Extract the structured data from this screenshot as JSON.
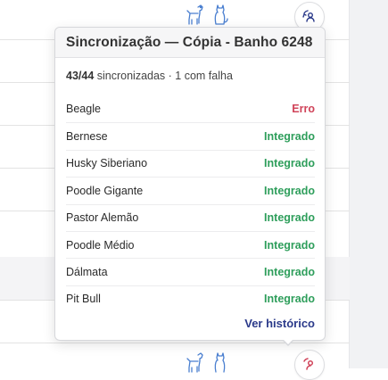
{
  "popover": {
    "title": "Sincronização — Cópia - Banho 6248",
    "summary_count": "43/44",
    "summary_rest": " sincronizadas · 1 com falha",
    "footer_link": "Ver histórico"
  },
  "rows": [
    {
      "name": "Beagle",
      "status": "Erro",
      "state": "error"
    },
    {
      "name": "Bernese",
      "status": "Integrado",
      "state": "ok"
    },
    {
      "name": "Husky Siberiano",
      "status": "Integrado",
      "state": "ok"
    },
    {
      "name": "Poodle Gigante",
      "status": "Integrado",
      "state": "ok"
    },
    {
      "name": "Pastor Alemão",
      "status": "Integrado",
      "state": "ok"
    },
    {
      "name": "Poodle Médio",
      "status": "Integrado",
      "state": "ok"
    },
    {
      "name": "Dálmata",
      "status": "Integrado",
      "state": "ok"
    },
    {
      "name": "Pit Bull",
      "status": "Integrado",
      "state": "ok"
    }
  ],
  "colors": {
    "ok": "#2e9e5b",
    "error": "#d0445a",
    "link": "#2b3a8a",
    "pet_icon": "#4a7fd0"
  },
  "icons": {
    "top_pets": [
      "dog-icon",
      "cat-icon"
    ],
    "bottom_pets": [
      "dog-icon",
      "cat-icon"
    ],
    "top_sync": "sync-user-icon",
    "bottom_sync": "sync-error-icon"
  }
}
